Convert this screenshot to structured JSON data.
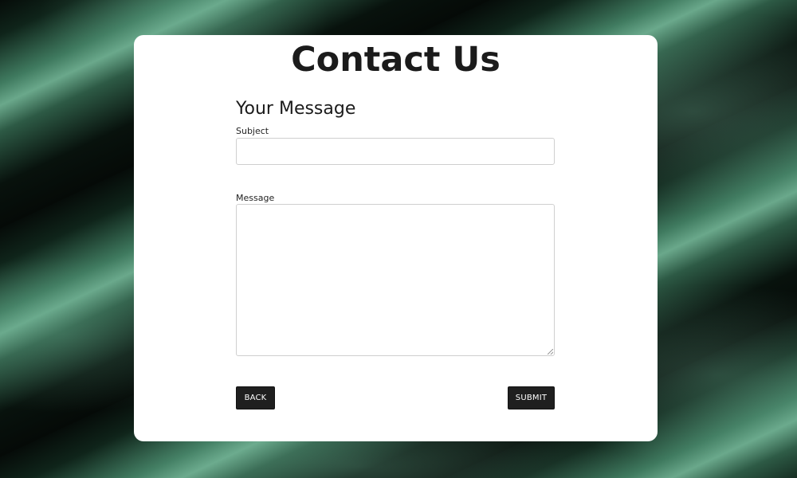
{
  "page": {
    "title": "Contact Us"
  },
  "form": {
    "section_title": "Your Message",
    "subject": {
      "label": "Subject",
      "value": "",
      "placeholder": ""
    },
    "message": {
      "label": "Message",
      "value": "",
      "placeholder": ""
    },
    "buttons": {
      "back_label": "BACK",
      "submit_label": "SUBMIT"
    }
  },
  "colors": {
    "card_background": "#ffffff",
    "button_background": "#1f1f1f",
    "button_text": "#ffffff",
    "title_text": "#1b1b1b",
    "background_accent": "#3f7a5f"
  }
}
